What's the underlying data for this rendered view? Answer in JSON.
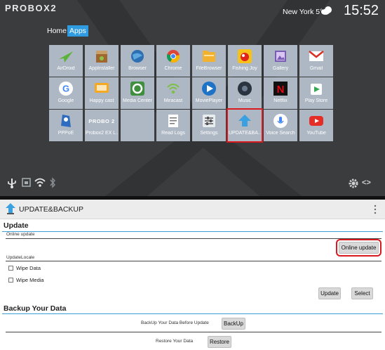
{
  "launcher": {
    "brand": "PROBOX2",
    "weather_text": "New York 5°C",
    "clock": "15:52",
    "tabs": [
      {
        "label": "Home",
        "active": false
      },
      {
        "label": "Apps",
        "active": true
      }
    ],
    "apps": [
      {
        "label": "AirDroid",
        "icon": "airdroid-icon"
      },
      {
        "label": "AppInstaller",
        "icon": "app-installer-icon"
      },
      {
        "label": "Browser",
        "icon": "browser-icon"
      },
      {
        "label": "Chrome",
        "icon": "chrome-icon"
      },
      {
        "label": "FileBrowser",
        "icon": "file-browser-icon"
      },
      {
        "label": "Fishing Joy",
        "icon": "fishing-joy-icon"
      },
      {
        "label": "Gallery",
        "icon": "gallery-icon"
      },
      {
        "label": "Gmail",
        "icon": "gmail-icon"
      },
      {
        "label": "Google",
        "icon": "google-icon"
      },
      {
        "label": "Happy cast",
        "icon": "happy-cast-icon"
      },
      {
        "label": "Media Center",
        "icon": "media-center-icon"
      },
      {
        "label": "Miracast",
        "icon": "miracast-icon"
      },
      {
        "label": "MoviePlayer",
        "icon": "movie-player-icon"
      },
      {
        "label": "Music",
        "icon": "music-icon"
      },
      {
        "label": "Netflix",
        "icon": "netflix-icon"
      },
      {
        "label": "Play Store",
        "icon": "play-store-icon"
      },
      {
        "label": "PPPoE",
        "icon": "pppoe-icon"
      },
      {
        "label": "Probox2 EX L...",
        "icon": "probox2-launcher-icon"
      },
      {
        "label": "",
        "icon": "blank-tile-icon"
      },
      {
        "label": "Read Logs",
        "icon": "read-logs-icon"
      },
      {
        "label": "Settings",
        "icon": "settings-icon"
      },
      {
        "label": "UPDATE&BA...",
        "icon": "update-backup-icon",
        "selected": true
      },
      {
        "label": "Voice Search",
        "icon": "voice-search-icon"
      },
      {
        "label": "YouTube",
        "icon": "youtube-icon"
      }
    ],
    "probox_logo_text": "PROBO 2",
    "colors": {
      "background": "#3b3c3d",
      "tile": "#aeb8c4",
      "accent": "#2f9be0",
      "highlight": "#d8191e"
    }
  },
  "app": {
    "title": "UPDATE&BACKUP",
    "update_section": {
      "title": "Update",
      "online_label": "Online update",
      "online_button": "Online update",
      "locale_label": "UpdateLocale",
      "options": [
        {
          "label": "Wipe Data",
          "checked": false
        },
        {
          "label": "Wipe Media",
          "checked": false
        }
      ],
      "update_button": "Update",
      "select_button": "Select"
    },
    "backup_section": {
      "title": "Backup Your Data",
      "backup_label": "BackUp Your Data Before Update",
      "backup_button": "BackUp",
      "restore_label": "Restore Your Data",
      "restore_button": "Restore"
    }
  }
}
